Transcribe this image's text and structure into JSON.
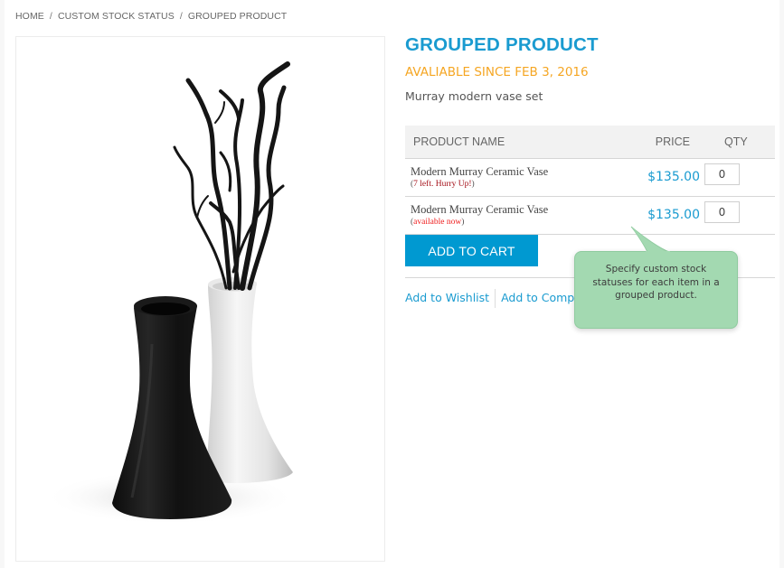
{
  "breadcrumb": {
    "items": [
      "HOME",
      "CUSTOM STOCK STATUS",
      "GROUPED PRODUCT"
    ],
    "separator": "/"
  },
  "product": {
    "image_alt": "Black and white Murray vases with decorative black branches",
    "title": "GROUPED PRODUCT",
    "availability": "AVALIABLE SINCE FEB 3, 2016",
    "description": "Murray modern vase set"
  },
  "table": {
    "headers": {
      "name": "PRODUCT NAME",
      "price": "PRICE",
      "qty": "QTY"
    },
    "rows": [
      {
        "name": "Modern Murray Ceramic Vase",
        "status_open": "(",
        "status": "7 left. Hurry Up!",
        "status_close": ")",
        "price": "$135.00",
        "qty": "0"
      },
      {
        "name": "Modern Murray Ceramic Vase",
        "status_open": "(",
        "status": "available now",
        "status_close": ")",
        "price": "$135.00",
        "qty": "0"
      }
    ]
  },
  "actions": {
    "add_to_cart": "ADD TO CART",
    "add_to_wishlist": "Add to Wishlist",
    "add_to_compare": "Add to Compare"
  },
  "tooltip": {
    "text": "Specify custom stock statuses for each item in a grouped product."
  },
  "colors": {
    "accent": "#1a9bd0",
    "button": "#0099d1",
    "availability": "#f5a623",
    "low_stock": "#a5111a",
    "available_now": "#ee1c1c",
    "tooltip_bg": "#a3d9b1"
  }
}
